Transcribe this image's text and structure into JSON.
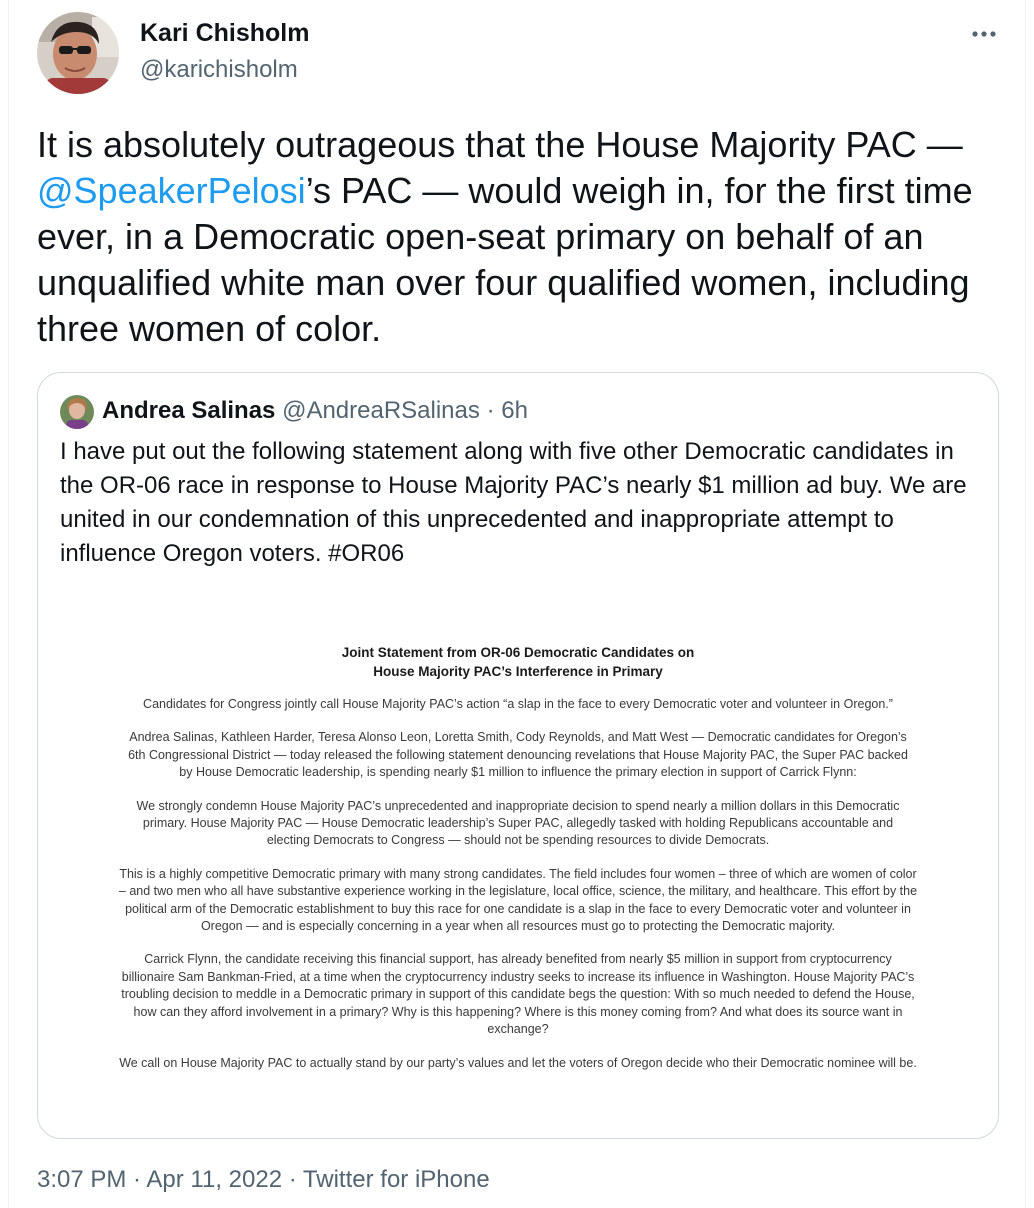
{
  "author": {
    "name": "Kari Chisholm",
    "handle": "@karichisholm"
  },
  "tweet": {
    "text_before": "It is absolutely outrageous that the House Majority PAC — ",
    "mention": "@SpeakerPelosi",
    "text_after": "’s PAC — would weigh in, for the first time ever, in a Democratic open-seat primary on behalf of an unqualified white man over four qualified women, including three women of color."
  },
  "quoted": {
    "name": "Andrea Salinas",
    "handle": "@AndreaRSalinas",
    "separator": "·",
    "age": "6h",
    "text": "I have put out the following statement along with five other Democratic candidates in the OR-06 race in response to House Majority PAC’s nearly $1 million ad buy. We are united in our condemnation of this unprecedented and inappropriate attempt to influence Oregon voters. #OR06",
    "document": {
      "title_line1": "Joint Statement from OR-06 Democratic Candidates on",
      "title_line2": "House Majority PAC’s Interference in Primary",
      "p1": "Candidates for Congress jointly call House Majority PAC’s action “a slap in the face to every Democratic voter and volunteer in Oregon.”",
      "p2": "Andrea Salinas, Kathleen Harder, Teresa Alonso Leon, Loretta Smith, Cody Reynolds, and Matt West — Democratic candidates for Oregon’s 6th Congressional District — today released the following statement denouncing revelations that House Majority PAC, the Super PAC backed by House Democratic leadership, is spending nearly $1 million to influence the primary election in support of Carrick Flynn:",
      "p3": "We strongly condemn House Majority PAC’s unprecedented and inappropriate decision to spend nearly a million dollars in this Democratic primary. House Majority PAC — House Democratic leadership’s Super PAC, allegedly tasked with holding Republicans accountable and electing Democrats to Congress — should not be spending resources to divide Democrats.",
      "p4": "This is a highly competitive Democratic primary with many strong candidates. The field includes four women – three of which are women of color – and two men who all have substantive experience working in the legislature, local office, science, the military, and healthcare. This effort by the political arm of the Democratic establishment to buy this race for one candidate is a slap in the face to every Democratic voter and volunteer in Oregon — and is especially concerning in a year when all resources must go to protecting the Democratic majority.",
      "p5": "Carrick Flynn, the candidate receiving this financial support, has already benefited from nearly $5 million in support from cryptocurrency billionaire Sam Bankman-Fried, at a time when the cryptocurrency industry seeks to increase its influence in Washington. House Majority PAC’s troubling decision to meddle in a Democratic primary in support of this candidate begs the question: With so much needed to defend the House, how can they afford involvement in a primary? Why is this happening? Where is this money coming from? And what does its source want in exchange?",
      "p6": "We call on House Majority PAC to actually stand by our party’s values and let the voters of Oregon decide who their Democratic nominee will be."
    }
  },
  "footer": {
    "timestamp": "3:07 PM · Apr 11, 2022 · Twitter for iPhone"
  },
  "icons": {
    "more": "more-dots-icon"
  },
  "colors": {
    "text": "#0f1419",
    "secondary": "#536471",
    "link": "#1d9bf0",
    "border": "#cfd9de"
  }
}
